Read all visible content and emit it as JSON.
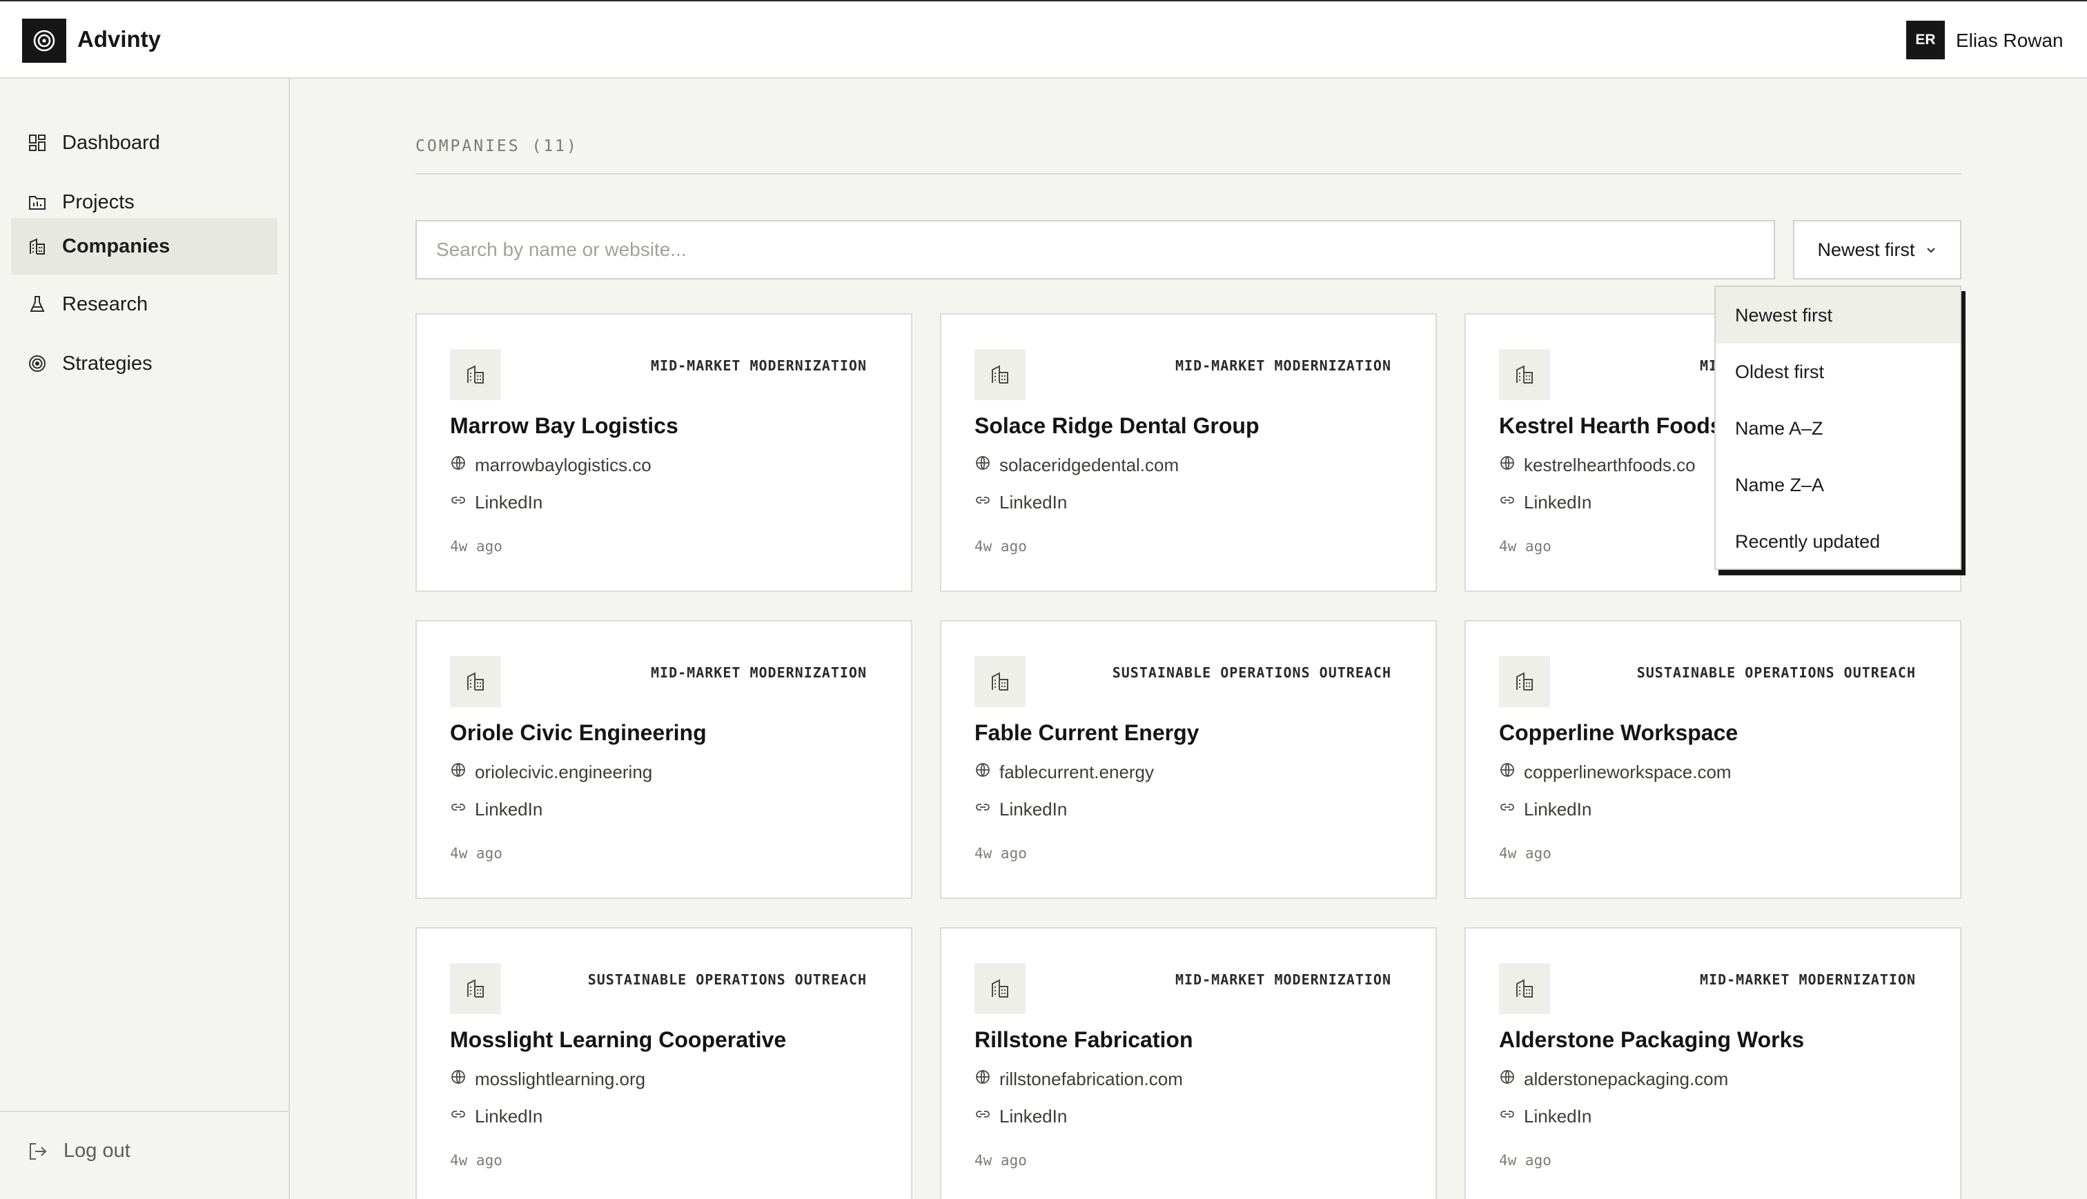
{
  "app": {
    "brand": "Advinty",
    "logo_icon": "target-icon"
  },
  "user": {
    "initials": "ER",
    "name": "Elias Rowan"
  },
  "sidebar": {
    "items": [
      {
        "label": "Dashboard",
        "icon": "dashboard-grid-icon",
        "active": false
      },
      {
        "label": "Projects",
        "icon": "folder-chart-icon",
        "active": false
      },
      {
        "label": "Companies",
        "icon": "building-icon",
        "active": true
      },
      {
        "label": "Research",
        "icon": "flask-icon",
        "active": false
      },
      {
        "label": "Strategies",
        "icon": "target-icon",
        "active": false
      }
    ],
    "logout_label": "Log out"
  },
  "main": {
    "section_title": "COMPANIES (11)",
    "search_placeholder": "Search by name or website...",
    "sort": {
      "selected": "Newest first",
      "options": [
        "Newest first",
        "Oldest first",
        "Name A–Z",
        "Name Z–A",
        "Recently updated"
      ]
    },
    "companies": [
      {
        "name": "Marrow Bay Logistics",
        "tag": "MID-MARKET MODERNIZATION",
        "website": "marrowbaylogistics.co",
        "link": "LinkedIn",
        "time": "4w ago"
      },
      {
        "name": "Solace Ridge Dental Group",
        "tag": "MID-MARKET MODERNIZATION",
        "website": "solaceridgedental.com",
        "link": "LinkedIn",
        "time": "4w ago"
      },
      {
        "name": "Kestrel Hearth Foods",
        "tag": "MID-MARKET MODERNIZATION",
        "website": "kestrelhearthfoods.co",
        "link": "LinkedIn",
        "time": "4w ago"
      },
      {
        "name": "Oriole Civic Engineering",
        "tag": "MID-MARKET MODERNIZATION",
        "website": "oriolecivic.engineering",
        "link": "LinkedIn",
        "time": "4w ago"
      },
      {
        "name": "Fable Current Energy",
        "tag": "SUSTAINABLE OPERATIONS OUTREACH",
        "website": "fablecurrent.energy",
        "link": "LinkedIn",
        "time": "4w ago"
      },
      {
        "name": "Copperline Workspace",
        "tag": "SUSTAINABLE OPERATIONS OUTREACH",
        "website": "copperlineworkspace.com",
        "link": "LinkedIn",
        "time": "4w ago"
      },
      {
        "name": "Mosslight Learning Cooperative",
        "tag": "SUSTAINABLE OPERATIONS OUTREACH",
        "website": "mosslightlearning.org",
        "link": "LinkedIn",
        "time": "4w ago"
      },
      {
        "name": "Rillstone Fabrication",
        "tag": "MID-MARKET MODERNIZATION",
        "website": "rillstonefabrication.com",
        "link": "LinkedIn",
        "time": "4w ago"
      },
      {
        "name": "Alderstone Packaging Works",
        "tag": "MID-MARKET MODERNIZATION",
        "website": "alderstonepackaging.com",
        "link": "LinkedIn",
        "time": "4w ago"
      }
    ]
  }
}
